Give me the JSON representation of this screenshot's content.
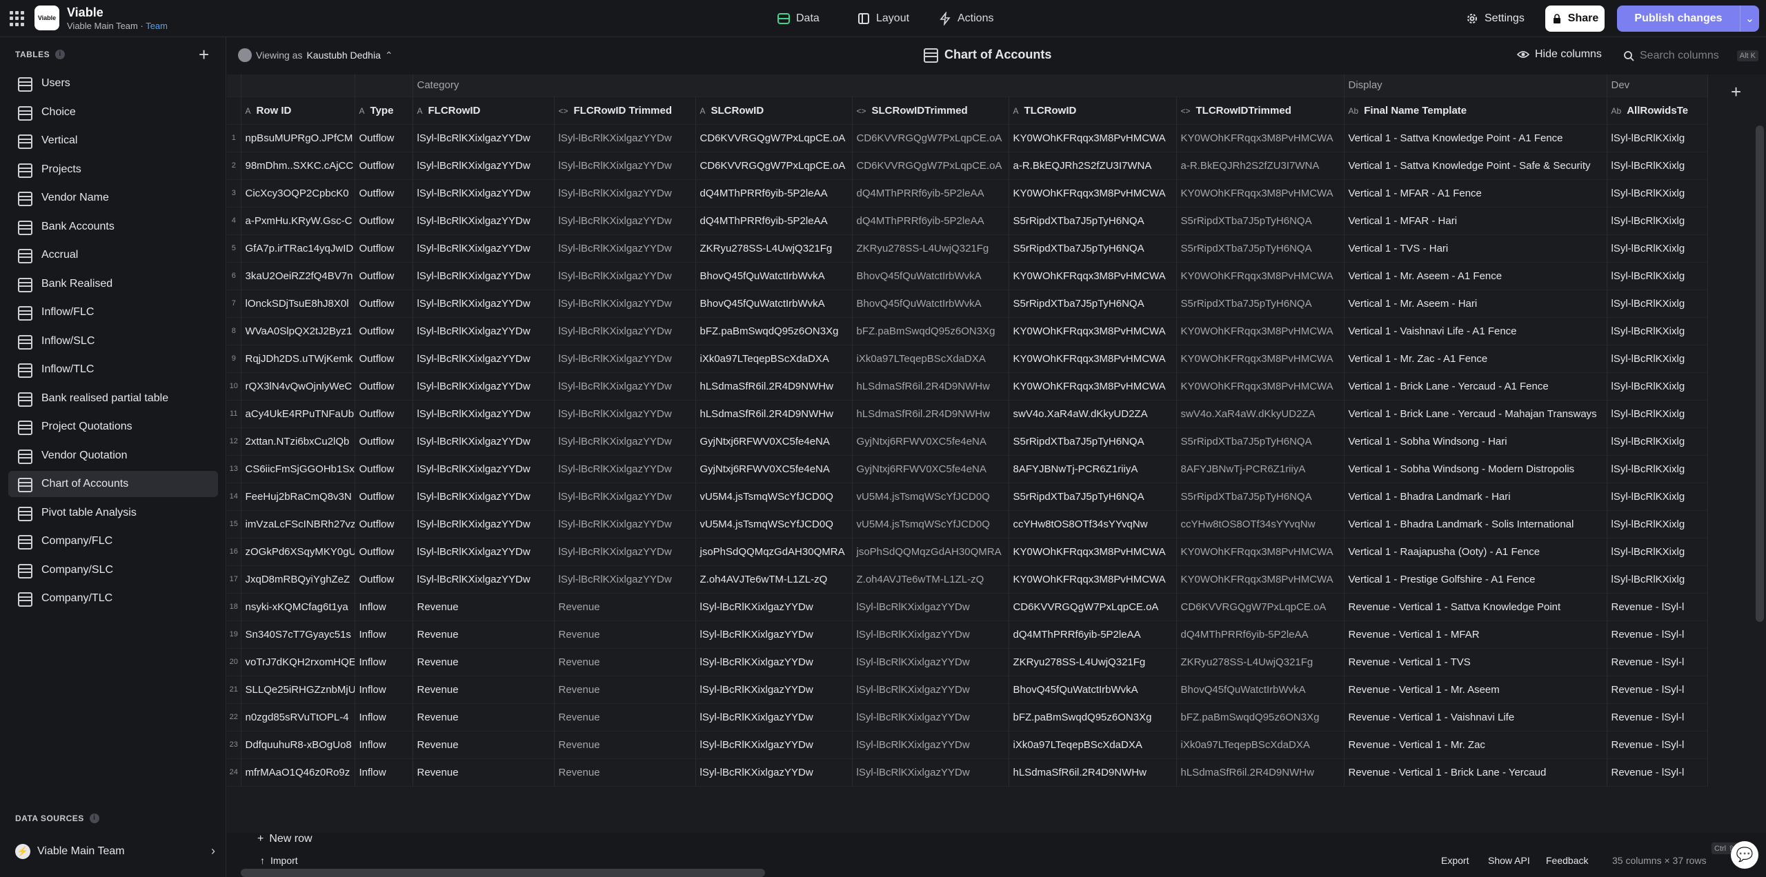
{
  "app": {
    "logo_text": "Viable",
    "name": "Viable",
    "team_line": "Viable Main Team · ",
    "team_tag": "Team"
  },
  "nav": {
    "data": "Data",
    "layout": "Layout",
    "actions": "Actions"
  },
  "topright": {
    "settings": "Settings",
    "share": "Share",
    "publish": "Publish changes"
  },
  "sidebar": {
    "tables_label": "TABLES",
    "items": [
      "Users",
      "Choice",
      "Vertical",
      "Projects",
      "Vendor Name",
      "Bank Accounts",
      "Accrual",
      "Bank Realised",
      "Inflow/FLC",
      "Inflow/SLC",
      "Inflow/TLC",
      "Bank realised partial table",
      "Project Quotations",
      "Vendor Quotation",
      "Chart of Accounts",
      "Pivot table Analysis",
      "Company/FLC",
      "Company/SLC",
      "Company/TLC"
    ],
    "active": "Chart of Accounts",
    "data_sources_label": "DATA SOURCES",
    "data_source": "Viable Main Team"
  },
  "subbar": {
    "viewing_prefix": "Viewing as",
    "viewing_user": "Kaustubh Dedhia",
    "page_title": "Chart of Accounts",
    "hide_columns": "Hide columns",
    "search_placeholder": "Search columns",
    "search_kbd": "Alt K"
  },
  "grid": {
    "groups": {
      "category": "Category",
      "display": "Display",
      "dev": "Dev"
    },
    "columns": [
      {
        "type": "A",
        "label": "Row ID"
      },
      {
        "type": "A",
        "label": "Type"
      },
      {
        "type": "A",
        "label": "FLCRowID"
      },
      {
        "type": "<>",
        "label": "FLCRowID Trimmed"
      },
      {
        "type": "A",
        "label": "SLCRowID"
      },
      {
        "type": "<>",
        "label": "SLCRowIDTrimmed"
      },
      {
        "type": "A",
        "label": "TLCRowID"
      },
      {
        "type": "<>",
        "label": "TLCRowIDTrimmed"
      },
      {
        "type": "Ab",
        "label": "Final Name Template"
      },
      {
        "type": "Ab",
        "label": "AllRowidsTe"
      }
    ],
    "rows": [
      [
        "1",
        "npBsuMUPRgO.JPfCM",
        "Outflow",
        "lSyl-lBcRlKXixlgazYYDw",
        "lSyl-lBcRlKXixlgazYYDw",
        "CD6KVVRGQgW7PxLqpCE.oA",
        "CD6KVVRGQgW7PxLqpCE.oA",
        "KY0WOhKFRqqx3M8PvHMCWA",
        "KY0WOhKFRqqx3M8PvHMCWA",
        "Vertical 1 - Sattva Knowledge Point - A1 Fence",
        "lSyl-lBcRlKXixlg"
      ],
      [
        "2",
        "98mDhm..SXKC.cAjCC",
        "Outflow",
        "lSyl-lBcRlKXixlgazYYDw",
        "lSyl-lBcRlKXixlgazYYDw",
        "CD6KVVRGQgW7PxLqpCE.oA",
        "CD6KVVRGQgW7PxLqpCE.oA",
        "a-R.BkEQJRh2S2fZU3I7WNA",
        "a-R.BkEQJRh2S2fZU3I7WNA",
        "Vertical 1 - Sattva Knowledge Point - Safe & Security",
        "lSyl-lBcRlKXixlg"
      ],
      [
        "3",
        "CicXcy3OQP2CpbcK0",
        "Outflow",
        "lSyl-lBcRlKXixlgazYYDw",
        "lSyl-lBcRlKXixlgazYYDw",
        "dQ4MThPRRf6yib-5P2leAA",
        "dQ4MThPRRf6yib-5P2leAA",
        "KY0WOhKFRqqx3M8PvHMCWA",
        "KY0WOhKFRqqx3M8PvHMCWA",
        "Vertical 1 - MFAR - A1 Fence",
        "lSyl-lBcRlKXixlg"
      ],
      [
        "4",
        "a-PxmHu.KRyW.Gsc-C",
        "Outflow",
        "lSyl-lBcRlKXixlgazYYDw",
        "lSyl-lBcRlKXixlgazYYDw",
        "dQ4MThPRRf6yib-5P2leAA",
        "dQ4MThPRRf6yib-5P2leAA",
        "S5rRipdXTba7J5pTyH6NQA",
        "S5rRipdXTba7J5pTyH6NQA",
        "Vertical 1 - MFAR - Hari",
        "lSyl-lBcRlKXixlg"
      ],
      [
        "5",
        "GfA7p.irTRac14yqJwID",
        "Outflow",
        "lSyl-lBcRlKXixlgazYYDw",
        "lSyl-lBcRlKXixlgazYYDw",
        "ZKRyu278SS-L4UwjQ321Fg",
        "ZKRyu278SS-L4UwjQ321Fg",
        "S5rRipdXTba7J5pTyH6NQA",
        "S5rRipdXTba7J5pTyH6NQA",
        "Vertical 1 - TVS - Hari",
        "lSyl-lBcRlKXixlg"
      ],
      [
        "6",
        "3kaU2OeiRZ2fQ4BV7n",
        "Outflow",
        "lSyl-lBcRlKXixlgazYYDw",
        "lSyl-lBcRlKXixlgazYYDw",
        "BhovQ45fQuWatctIrbWvkA",
        "BhovQ45fQuWatctIrbWvkA",
        "KY0WOhKFRqqx3M8PvHMCWA",
        "KY0WOhKFRqqx3M8PvHMCWA",
        "Vertical 1 - Mr. Aseem - A1 Fence",
        "lSyl-lBcRlKXixlg"
      ],
      [
        "7",
        "lOnckSDjTsuE8hJ8X0l",
        "Outflow",
        "lSyl-lBcRlKXixlgazYYDw",
        "lSyl-lBcRlKXixlgazYYDw",
        "BhovQ45fQuWatctIrbWvkA",
        "BhovQ45fQuWatctIrbWvkA",
        "S5rRipdXTba7J5pTyH6NQA",
        "S5rRipdXTba7J5pTyH6NQA",
        "Vertical 1 - Mr. Aseem - Hari",
        "lSyl-lBcRlKXixlg"
      ],
      [
        "8",
        "WVaA0SlpQX2tJ2Byz1",
        "Outflow",
        "lSyl-lBcRlKXixlgazYYDw",
        "lSyl-lBcRlKXixlgazYYDw",
        "bFZ.paBmSwqdQ95z6ON3Xg",
        "bFZ.paBmSwqdQ95z6ON3Xg",
        "KY0WOhKFRqqx3M8PvHMCWA",
        "KY0WOhKFRqqx3M8PvHMCWA",
        "Vertical 1 - Vaishnavi Life - A1 Fence",
        "lSyl-lBcRlKXixlg"
      ],
      [
        "9",
        "RqjJDh2DS.uTWjKemk",
        "Outflow",
        "lSyl-lBcRlKXixlgazYYDw",
        "lSyl-lBcRlKXixlgazYYDw",
        "iXk0a97LTeqepBScXdaDXA",
        "iXk0a97LTeqepBScXdaDXA",
        "KY0WOhKFRqqx3M8PvHMCWA",
        "KY0WOhKFRqqx3M8PvHMCWA",
        "Vertical 1 - Mr. Zac - A1 Fence",
        "lSyl-lBcRlKXixlg"
      ],
      [
        "10",
        "rQX3lN4vQwOjnlyWeC",
        "Outflow",
        "lSyl-lBcRlKXixlgazYYDw",
        "lSyl-lBcRlKXixlgazYYDw",
        "hLSdmaSfR6il.2R4D9NWHw",
        "hLSdmaSfR6il.2R4D9NWHw",
        "KY0WOhKFRqqx3M8PvHMCWA",
        "KY0WOhKFRqqx3M8PvHMCWA",
        "Vertical 1 - Brick Lane - Yercaud - A1 Fence",
        "lSyl-lBcRlKXixlg"
      ],
      [
        "11",
        "aCy4UkE4RPuTNFaUb",
        "Outflow",
        "lSyl-lBcRlKXixlgazYYDw",
        "lSyl-lBcRlKXixlgazYYDw",
        "hLSdmaSfR6il.2R4D9NWHw",
        "hLSdmaSfR6il.2R4D9NWHw",
        "swV4o.XaR4aW.dKkyUD2ZA",
        "swV4o.XaR4aW.dKkyUD2ZA",
        "Vertical 1 - Brick Lane - Yercaud - Mahajan Transways",
        "lSyl-lBcRlKXixlg"
      ],
      [
        "12",
        "2xttan.NTzi6bxCu2lQb",
        "Outflow",
        "lSyl-lBcRlKXixlgazYYDw",
        "lSyl-lBcRlKXixlgazYYDw",
        "GyjNtxj6RFWV0XC5fe4eNA",
        "GyjNtxj6RFWV0XC5fe4eNA",
        "S5rRipdXTba7J5pTyH6NQA",
        "S5rRipdXTba7J5pTyH6NQA",
        "Vertical 1 - Sobha Windsong - Hari",
        "lSyl-lBcRlKXixlg"
      ],
      [
        "13",
        "CS6iicFmSjGGOHb1Sx",
        "Outflow",
        "lSyl-lBcRlKXixlgazYYDw",
        "lSyl-lBcRlKXixlgazYYDw",
        "GyjNtxj6RFWV0XC5fe4eNA",
        "GyjNtxj6RFWV0XC5fe4eNA",
        "8AFYJBNwTj-PCR6Z1riiyA",
        "8AFYJBNwTj-PCR6Z1riiyA",
        "Vertical 1 - Sobha Windsong - Modern Distropolis",
        "lSyl-lBcRlKXixlg"
      ],
      [
        "14",
        "FeeHuj2bRaCmQ8v3N",
        "Outflow",
        "lSyl-lBcRlKXixlgazYYDw",
        "lSyl-lBcRlKXixlgazYYDw",
        "vU5M4.jsTsmqWScYfJCD0Q",
        "vU5M4.jsTsmqWScYfJCD0Q",
        "S5rRipdXTba7J5pTyH6NQA",
        "S5rRipdXTba7J5pTyH6NQA",
        "Vertical 1 - Bhadra Landmark - Hari",
        "lSyl-lBcRlKXixlg"
      ],
      [
        "15",
        "imVzaLcFScINBRh27vz",
        "Outflow",
        "lSyl-lBcRlKXixlgazYYDw",
        "lSyl-lBcRlKXixlgazYYDw",
        "vU5M4.jsTsmqWScYfJCD0Q",
        "vU5M4.jsTsmqWScYfJCD0Q",
        "ccYHw8tOS8OTf34sYYvqNw",
        "ccYHw8tOS8OTf34sYYvqNw",
        "Vertical 1 - Bhadra Landmark - Solis International",
        "lSyl-lBcRlKXixlg"
      ],
      [
        "16",
        "zOGkPd6XSqyMKY0gU",
        "Outflow",
        "lSyl-lBcRlKXixlgazYYDw",
        "lSyl-lBcRlKXixlgazYYDw",
        "jsoPhSdQQMqzGdAH30QMRA",
        "jsoPhSdQQMqzGdAH30QMRA",
        "KY0WOhKFRqqx3M8PvHMCWA",
        "KY0WOhKFRqqx3M8PvHMCWA",
        "Vertical 1 - Raajapusha (Ooty) - A1 Fence",
        "lSyl-lBcRlKXixlg"
      ],
      [
        "17",
        "JxqD8mRBQyiYghZeZ",
        "Outflow",
        "lSyl-lBcRlKXixlgazYYDw",
        "lSyl-lBcRlKXixlgazYYDw",
        "Z.oh4AVJTe6wTM-L1ZL-zQ",
        "Z.oh4AVJTe6wTM-L1ZL-zQ",
        "KY0WOhKFRqqx3M8PvHMCWA",
        "KY0WOhKFRqqx3M8PvHMCWA",
        "Vertical 1 - Prestige Golfshire - A1 Fence",
        "lSyl-lBcRlKXixlg"
      ],
      [
        "18",
        "nsyki-xKQMCfag6t1ya",
        "Inflow",
        "Revenue",
        "Revenue",
        "lSyl-lBcRlKXixlgazYYDw",
        "lSyl-lBcRlKXixlgazYYDw",
        "CD6KVVRGQgW7PxLqpCE.oA",
        "CD6KVVRGQgW7PxLqpCE.oA",
        "Revenue - Vertical 1 - Sattva Knowledge Point",
        "Revenue - lSyl-l"
      ],
      [
        "19",
        "Sn340S7cT7Gyayc51s",
        "Inflow",
        "Revenue",
        "Revenue",
        "lSyl-lBcRlKXixlgazYYDw",
        "lSyl-lBcRlKXixlgazYYDw",
        "dQ4MThPRRf6yib-5P2leAA",
        "dQ4MThPRRf6yib-5P2leAA",
        "Revenue - Vertical 1 - MFAR",
        "Revenue - lSyl-l"
      ],
      [
        "20",
        "voTrJ7dKQH2rxomHQE",
        "Inflow",
        "Revenue",
        "Revenue",
        "lSyl-lBcRlKXixlgazYYDw",
        "lSyl-lBcRlKXixlgazYYDw",
        "ZKRyu278SS-L4UwjQ321Fg",
        "ZKRyu278SS-L4UwjQ321Fg",
        "Revenue - Vertical 1 - TVS",
        "Revenue - lSyl-l"
      ],
      [
        "21",
        "SLLQe25iRHGZznbMjU",
        "Inflow",
        "Revenue",
        "Revenue",
        "lSyl-lBcRlKXixlgazYYDw",
        "lSyl-lBcRlKXixlgazYYDw",
        "BhovQ45fQuWatctIrbWvkA",
        "BhovQ45fQuWatctIrbWvkA",
        "Revenue - Vertical 1 - Mr. Aseem",
        "Revenue - lSyl-l"
      ],
      [
        "22",
        "n0zgd85sRVuTtOPL-4",
        "Inflow",
        "Revenue",
        "Revenue",
        "lSyl-lBcRlKXixlgazYYDw",
        "lSyl-lBcRlKXixlgazYYDw",
        "bFZ.paBmSwqdQ95z6ON3Xg",
        "bFZ.paBmSwqdQ95z6ON3Xg",
        "Revenue - Vertical 1 - Vaishnavi Life",
        "Revenue - lSyl-l"
      ],
      [
        "23",
        "DdfquuhuR8-xBOgUo8",
        "Inflow",
        "Revenue",
        "Revenue",
        "lSyl-lBcRlKXixlgazYYDw",
        "lSyl-lBcRlKXixlgazYYDw",
        "iXk0a97LTeqepBScXdaDXA",
        "iXk0a97LTeqepBScXdaDXA",
        "Revenue - Vertical 1 - Mr. Zac",
        "Revenue - lSyl-l"
      ],
      [
        "24",
        "mfrMAaO1Q46z0Ro9z",
        "Inflow",
        "Revenue",
        "Revenue",
        "lSyl-lBcRlKXixlgazYYDw",
        "lSyl-lBcRlKXixlgazYYDw",
        "hLSdmaSfR6il.2R4D9NWHw",
        "hLSdmaSfR6il.2R4D9NWHw",
        "Revenue - Vertical 1 - Brick Lane - Yercaud",
        "Revenue - lSyl-l"
      ]
    ],
    "new_row": "New row",
    "ctrl_hint": "Ctrl ⇧↵"
  },
  "footer": {
    "import": "Import",
    "export": "Export",
    "show_api": "Show API",
    "feedback": "Feedback",
    "summary": "35 columns × 37 rows"
  }
}
